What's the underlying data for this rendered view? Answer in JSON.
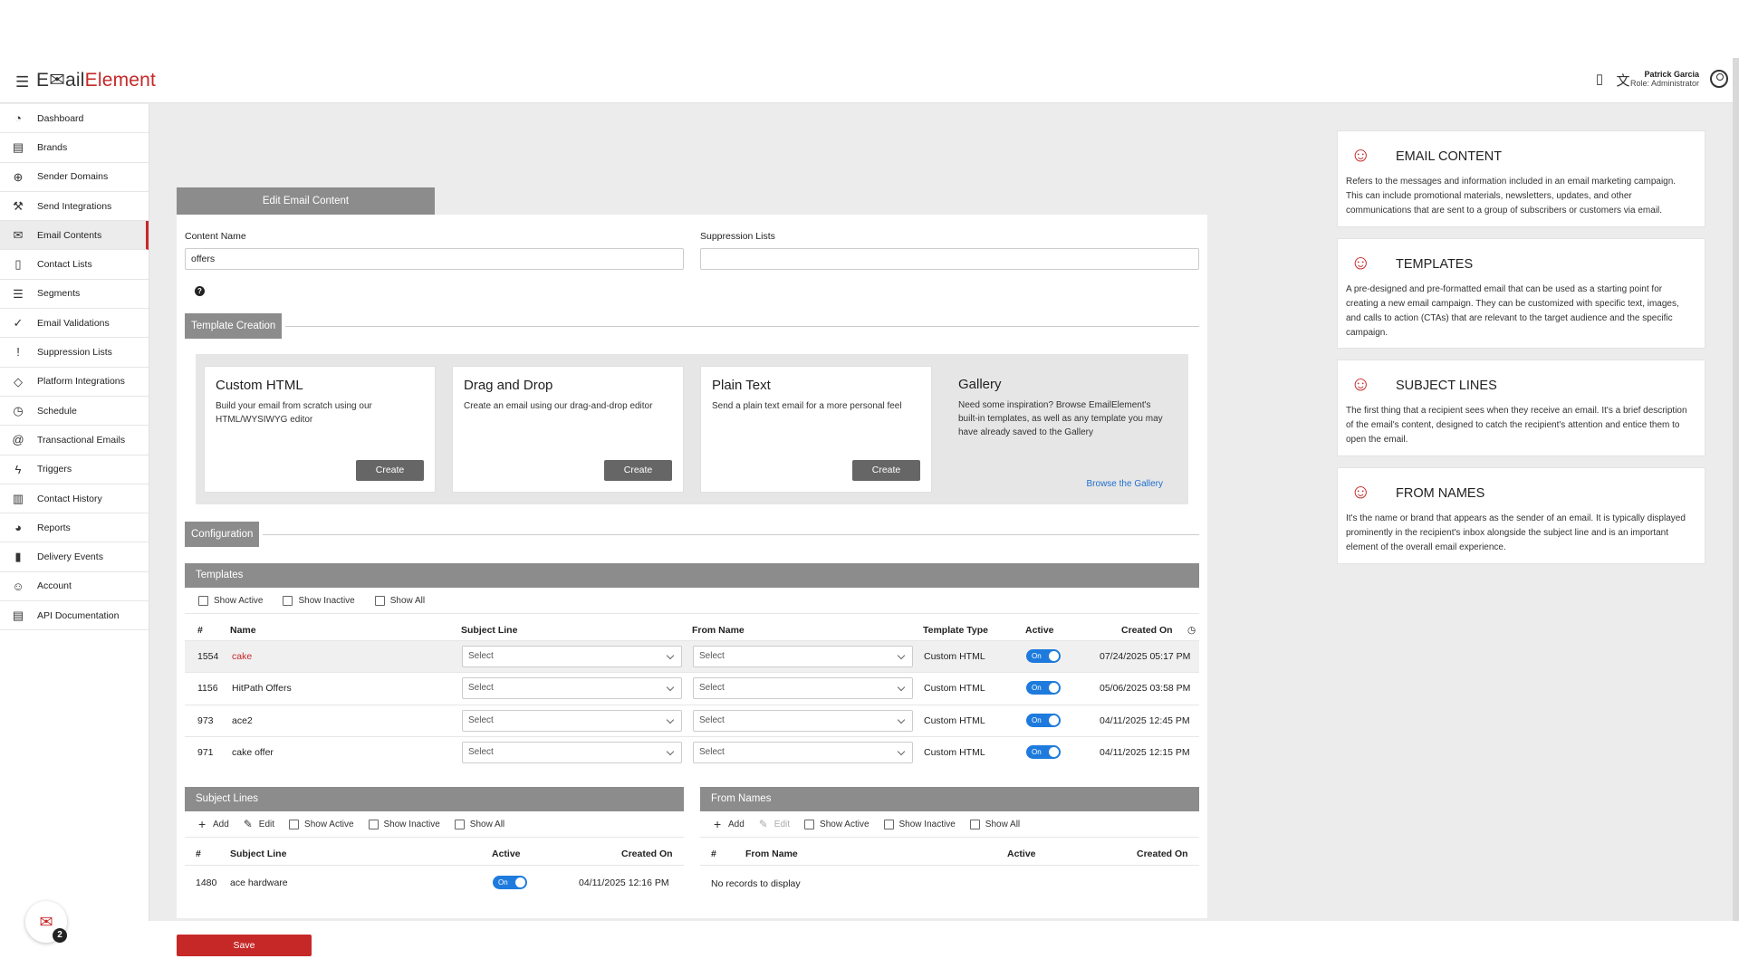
{
  "app": {
    "logo_part1": "E",
    "logo_icon": "✉",
    "logo_part2": "ail",
    "logo_part3": "Element"
  },
  "user": {
    "name": "Patrick Garcia",
    "role": "Role: Administrator"
  },
  "sidebar": {
    "items": [
      {
        "label": "Dashboard",
        "icon": "dashboard-icon",
        "glyph": "◔"
      },
      {
        "label": "Brands",
        "icon": "brands-icon",
        "glyph": "▤"
      },
      {
        "label": "Sender Domains",
        "icon": "globe-icon",
        "glyph": "⊕"
      },
      {
        "label": "Send Integrations",
        "icon": "wrench-icon",
        "glyph": "⚒"
      },
      {
        "label": "Email Contents",
        "icon": "envelope-icon",
        "glyph": "✉"
      },
      {
        "label": "Contact Lists",
        "icon": "contact-book-icon",
        "glyph": "▯"
      },
      {
        "label": "Segments",
        "icon": "segments-icon",
        "glyph": "☰"
      },
      {
        "label": "Email Validations",
        "icon": "check-circle-icon",
        "glyph": "✓"
      },
      {
        "label": "Suppression Lists",
        "icon": "alert-circle-icon",
        "glyph": "!"
      },
      {
        "label": "Platform Integrations",
        "icon": "tag-icon",
        "glyph": "◇"
      },
      {
        "label": "Schedule",
        "icon": "clock-icon",
        "glyph": "◷"
      },
      {
        "label": "Transactional Emails",
        "icon": "at-icon",
        "glyph": "@"
      },
      {
        "label": "Triggers",
        "icon": "bolt-icon",
        "glyph": "ϟ"
      },
      {
        "label": "Contact History",
        "icon": "clipboard-icon",
        "glyph": "▥"
      },
      {
        "label": "Reports",
        "icon": "pie-chart-icon",
        "glyph": "◕"
      },
      {
        "label": "Delivery Events",
        "icon": "bar-chart-icon",
        "glyph": "▮"
      },
      {
        "label": "Account",
        "icon": "user-circle-icon",
        "glyph": "☺"
      },
      {
        "label": "API Documentation",
        "icon": "document-icon",
        "glyph": "▤"
      }
    ],
    "notification_count": "2"
  },
  "panel": {
    "tab_label": "Edit Email Content",
    "content_name_label": "Content Name",
    "content_name_value": "offers",
    "suppression_label": "Suppression Lists",
    "suppression_value": "",
    "help_glyph": "?",
    "template_creation_label": "Template Creation",
    "configuration_label": "Configuration"
  },
  "creation": {
    "cards": [
      {
        "title": "Custom HTML",
        "desc": "Build your email from scratch using our HTML/WYSIWYG editor",
        "button": "Create"
      },
      {
        "title": "Drag and Drop",
        "desc": "Create an email using our drag-and-drop editor",
        "button": "Create"
      },
      {
        "title": "Plain Text",
        "desc": "Send a plain text email for a more personal feel",
        "button": "Create"
      }
    ],
    "gallery": {
      "title": "Gallery",
      "desc": "Need some inspiration? Browse EmailElement's built-in templates, as well as any template you may have already saved to the Gallery",
      "link": "Browse the Gallery"
    }
  },
  "templates": {
    "title": "Templates",
    "toolbar": {
      "show_active": "Show Active",
      "show_inactive": "Show Inactive",
      "show_all": "Show All"
    },
    "headers": {
      "id": "#",
      "name": "Name",
      "subject": "Subject Line",
      "from": "From Name",
      "type": "Template Type",
      "active": "Active",
      "created": "Created On"
    },
    "rows": [
      {
        "id": "1554",
        "name": "cake",
        "subject": "Select",
        "from": "Select",
        "type": "Custom HTML",
        "active": "On",
        "created": "07/24/2025 05:17 PM"
      },
      {
        "id": "1156",
        "name": "HitPath Offers",
        "subject": "Select",
        "from": "Select",
        "type": "Custom HTML",
        "active": "On",
        "created": "05/06/2025 03:58 PM"
      },
      {
        "id": "973",
        "name": "ace2",
        "subject": "Select",
        "from": "Select",
        "type": "Custom HTML",
        "active": "On",
        "created": "04/11/2025 12:45 PM"
      },
      {
        "id": "971",
        "name": "cake offer",
        "subject": "Select",
        "from": "Select",
        "type": "Custom HTML",
        "active": "On",
        "created": "04/11/2025 12:15 PM"
      }
    ]
  },
  "subject_lines": {
    "title": "Subject Lines",
    "toolbar": {
      "add": "Add",
      "edit": "Edit",
      "show_active": "Show Active",
      "show_inactive": "Show Inactive",
      "show_all": "Show All"
    },
    "headers": {
      "id": "#",
      "name": "Subject Line",
      "active": "Active",
      "created": "Created On"
    },
    "rows": [
      {
        "id": "1480",
        "name": "ace hardware",
        "active": "On",
        "created": "04/11/2025 12:16 PM"
      }
    ]
  },
  "from_names": {
    "title": "From Names",
    "toolbar": {
      "add": "Add",
      "edit": "Edit",
      "show_active": "Show Active",
      "show_inactive": "Show Inactive",
      "show_all": "Show All"
    },
    "headers": {
      "id": "#",
      "name": "From Name",
      "active": "Active",
      "created": "Created On"
    },
    "empty": "No records to display"
  },
  "save_label": "Save",
  "info_cards": [
    {
      "title": "EMAIL CONTENT",
      "desc": "Refers to the messages and information included in an email marketing campaign. This can include promotional materials, newsletters, updates, and other communications that are sent to a group of subscribers or customers via email."
    },
    {
      "title": "TEMPLATES",
      "desc": "A pre-designed and pre-formatted email that can be used as a starting point for creating a new email campaign. They can be customized with specific text, images, and calls to action (CTAs) that are relevant to the target audience and the specific campaign."
    },
    {
      "title": "SUBJECT LINES",
      "desc": "The first thing that a recipient sees when they receive an email. It's a brief description of the email's content, designed to catch the recipient's attention and entice them to open the email."
    },
    {
      "title": "FROM NAMES",
      "desc": "It's the name or brand that appears as the sender of an email. It is typically displayed prominently in the recipient's inbox alongside the subject line and is an important element of the overall email experience."
    }
  ],
  "colors": {
    "brand": "#c62828",
    "toggle": "#1e7bdd",
    "bar": "#8c8c8c"
  }
}
